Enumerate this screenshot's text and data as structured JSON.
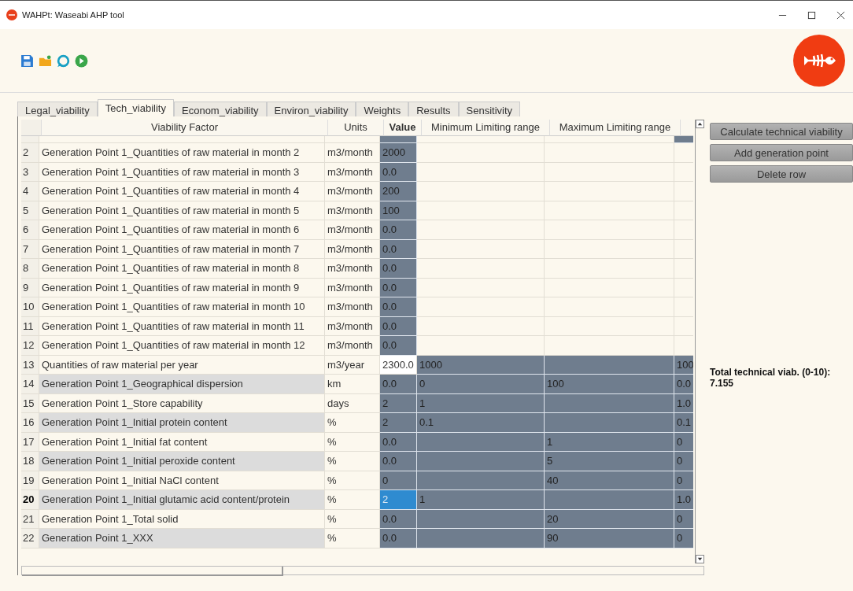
{
  "window": {
    "title": "WAHPt: Waseabi AHP tool"
  },
  "tabs": [
    {
      "label": "Legal_viability",
      "selected": false
    },
    {
      "label": "Tech_viability",
      "selected": true
    },
    {
      "label": "Econom_viability",
      "selected": false
    },
    {
      "label": "Environ_viability",
      "selected": false
    },
    {
      "label": "Weights",
      "selected": false
    },
    {
      "label": "Results",
      "selected": false
    },
    {
      "label": "Sensitivity",
      "selected": false
    }
  ],
  "table": {
    "columns": [
      "Viability Factor",
      "Units",
      "Value",
      "Minimum Limiting range",
      "Maximum Limiting range"
    ],
    "rows": [
      {
        "number": "2",
        "factor": "Generation Point 1_Quantities of raw material in month 2",
        "units": "m3/month",
        "value": "2000",
        "value_editable": true,
        "limits_editable": false,
        "shaded": false,
        "selected": false
      },
      {
        "number": "3",
        "factor": "Generation Point 1_Quantities of raw material in month 3",
        "units": "m3/month",
        "value": "0.0",
        "value_editable": true,
        "limits_editable": false,
        "shaded": false,
        "selected": false
      },
      {
        "number": "4",
        "factor": "Generation Point 1_Quantities of raw material in month 4",
        "units": "m3/month",
        "value": "200",
        "value_editable": true,
        "limits_editable": false,
        "shaded": false,
        "selected": false
      },
      {
        "number": "5",
        "factor": "Generation Point 1_Quantities of raw material in month 5",
        "units": "m3/month",
        "value": "100",
        "value_editable": true,
        "limits_editable": false,
        "shaded": false,
        "selected": false
      },
      {
        "number": "6",
        "factor": "Generation Point 1_Quantities of raw material in month 6",
        "units": "m3/month",
        "value": "0.0",
        "value_editable": true,
        "limits_editable": false,
        "shaded": false,
        "selected": false
      },
      {
        "number": "7",
        "factor": "Generation Point 1_Quantities of raw material in month 7",
        "units": "m3/month",
        "value": "0.0",
        "value_editable": true,
        "limits_editable": false,
        "shaded": false,
        "selected": false
      },
      {
        "number": "8",
        "factor": "Generation Point 1_Quantities of raw material in month 8",
        "units": "m3/month",
        "value": "0.0",
        "value_editable": true,
        "limits_editable": false,
        "shaded": false,
        "selected": false
      },
      {
        "number": "9",
        "factor": "Generation Point 1_Quantities of raw material in month 9",
        "units": "m3/month",
        "value": "0.0",
        "value_editable": true,
        "limits_editable": false,
        "shaded": false,
        "selected": false
      },
      {
        "number": "10",
        "factor": "Generation Point 1_Quantities of raw material in month 10",
        "units": "m3/month",
        "value": "0.0",
        "value_editable": true,
        "limits_editable": false,
        "shaded": false,
        "selected": false
      },
      {
        "number": "11",
        "factor": "Generation Point 1_Quantities of raw material in month 11",
        "units": "m3/month",
        "value": "0.0",
        "value_editable": true,
        "limits_editable": false,
        "shaded": false,
        "selected": false
      },
      {
        "number": "12",
        "factor": "Generation Point 1_Quantities of raw material in month 12",
        "units": "m3/month",
        "value": "0.0",
        "value_editable": true,
        "limits_editable": false,
        "shaded": false,
        "selected": false
      },
      {
        "number": "13",
        "factor": "Quantities of raw material per year",
        "units": "m3/year",
        "value": "2300.0",
        "minimum": "1000",
        "column_7": "100",
        "value_editable": false,
        "limits_editable": true,
        "shaded": false,
        "selected": false
      },
      {
        "number": "14",
        "factor": "Generation Point 1_Geographical dispersion",
        "units": "km",
        "value": "0.0",
        "minimum": "0",
        "maximum": "100",
        "column_7": "0.0",
        "value_editable": true,
        "limits_editable": true,
        "shaded": true,
        "selected": false
      },
      {
        "number": "15",
        "factor": "Generation Point 1_Store capability",
        "units": "days",
        "value": "2",
        "minimum": "1",
        "column_7": "1.0",
        "value_editable": true,
        "limits_editable": true,
        "shaded": false,
        "selected": false
      },
      {
        "number": "16",
        "factor": "Generation Point 1_Initial protein content",
        "units": "%",
        "value": "2",
        "minimum": "0.1",
        "column_7": "0.1",
        "value_editable": true,
        "limits_editable": true,
        "shaded": true,
        "selected": false
      },
      {
        "number": "17",
        "factor": "Generation Point 1_Initial fat content",
        "units": "%",
        "value": "0.0",
        "maximum": "1",
        "column_7": "0",
        "value_editable": true,
        "limits_editable": true,
        "shaded": false,
        "selected": false
      },
      {
        "number": "18",
        "factor": "Generation Point 1_Initial peroxide content",
        "units": "%",
        "value": "0.0",
        "maximum": "5",
        "column_7": "0",
        "value_editable": true,
        "limits_editable": true,
        "shaded": true,
        "selected": false
      },
      {
        "number": "19",
        "factor": "Generation Point 1_Initial NaCl content",
        "units": "%",
        "value": "0",
        "maximum": "40",
        "column_7": "0",
        "value_editable": true,
        "limits_editable": true,
        "shaded": false,
        "selected": false
      },
      {
        "number": "20",
        "factor": "Generation Point 1_Initial glutamic acid content/protein",
        "units": "%",
        "value": "2",
        "minimum": "1",
        "column_7": "1.0",
        "value_editable": true,
        "limits_editable": true,
        "shaded": true,
        "selected": true
      },
      {
        "number": "21",
        "factor": "Generation Point 1_Total solid",
        "units": "%",
        "value": "0.0",
        "maximum": "20",
        "column_7": "0",
        "value_editable": true,
        "limits_editable": true,
        "shaded": false,
        "selected": false
      },
      {
        "number": "22",
        "factor": "Generation Point 1_XXX",
        "units": "%",
        "value": "0.0",
        "maximum": "90",
        "column_7": "0",
        "value_editable": true,
        "limits_editable": true,
        "shaded": true,
        "selected": false
      }
    ]
  },
  "buttons": [
    "Calculate technical viability",
    "Add generation point",
    "Delete row"
  ],
  "result": {
    "label": "Total technical viab. (0-10):",
    "value": "7.155"
  }
}
